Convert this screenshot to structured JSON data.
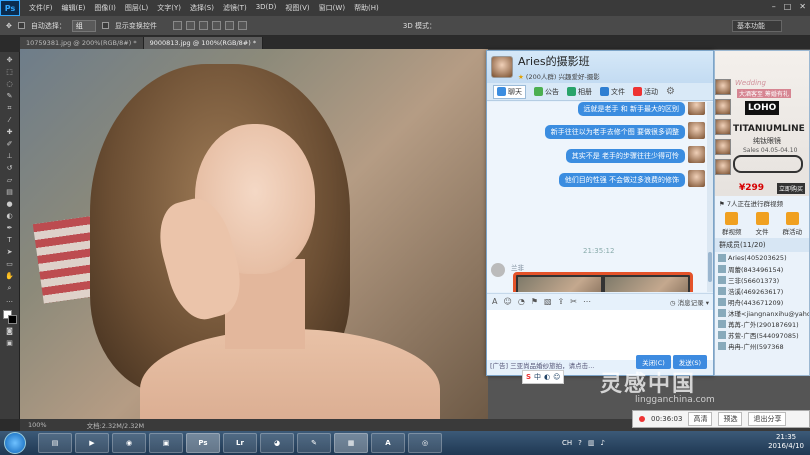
{
  "ps": {
    "logo": "Ps",
    "menu": [
      "文件(F)",
      "编辑(E)",
      "图像(I)",
      "图层(L)",
      "文字(Y)",
      "选择(S)",
      "滤镜(T)",
      "3D(D)",
      "视图(V)",
      "窗口(W)",
      "帮助(H)"
    ],
    "options": {
      "auto_select_label": "自动选择：",
      "auto_select_value": "组",
      "show_transform": "显示变换控件",
      "mode_3d": "3D 模式：",
      "workspace": "基本功能"
    },
    "tabs": [
      "10759381.jpg @ 200%(RGB/8#) *",
      "9000813.jpg @ 100%(RGB/8#) *"
    ],
    "status": {
      "zoom": "100%",
      "doc": "文档:2.32M/2.32M"
    }
  },
  "qq": {
    "group_name": "Aries的摄影班",
    "group_sub": "(200人群) 兴趣爱好-摄影",
    "tabs": [
      "聊天",
      "公告",
      "相册",
      "文件",
      "活动"
    ],
    "messages": [
      "远就是老手 和 新手最大的区别",
      "新手往往以为老手去修个图 要做很多调整",
      "其实不是 老手的步骤往往少得可怜",
      "他们目的性强 不会做过多浪费的修饰"
    ],
    "time": "21:35:12",
    "sender": "兰非",
    "record_label": "消息记录",
    "send_label": "发送(S)",
    "close_label": "关闭(C)",
    "notice": "[广告] 三亚尚品婚纱旅拍，请点击..."
  },
  "side": {
    "ad": {
      "wedding": "Wedding",
      "wedding_sub": "大酒客至 筹婚有礼",
      "logo": "LOHO",
      "brand": "TITANIUMLINE",
      "brand_sub": "纯钛眼镜",
      "date": "Sales 04.05-04.10",
      "price": "¥299",
      "buy": "立即购买"
    },
    "video_note": "7人正在进行群视频",
    "tools": [
      "群视频",
      "文件",
      "群活动"
    ],
    "members_title": "群成员(11/20)",
    "members": [
      "Aries(405203625)",
      "周蕾(843496154)",
      "三非(56601373)",
      "浩溪(469263617)",
      "明舟(443671209)",
      "沐瑾<jiangnanxihu@yahoo",
      "苒苒-广外(290187691)",
      "苏萱-广西(544097085)",
      "冉冉-广州(597368"
    ]
  },
  "tray": {
    "time": "00:36:03",
    "hd": "高清",
    "preview": "预选",
    "exit": "退出分享"
  },
  "watermark": {
    "text": "灵感中国",
    "url": "lingganchina.com"
  },
  "taskbar": {
    "apps": [
      "",
      "",
      "",
      "",
      "Ps",
      "Lr",
      "",
      "",
      "",
      "",
      ""
    ],
    "lang": "CH",
    "clock_time": "21:35",
    "clock_date": "2016/4/10"
  },
  "colors": {
    "qq_bubble": "#3b8de0",
    "highlight": "#e4532a",
    "ps_bg": "#3a3a3a"
  }
}
